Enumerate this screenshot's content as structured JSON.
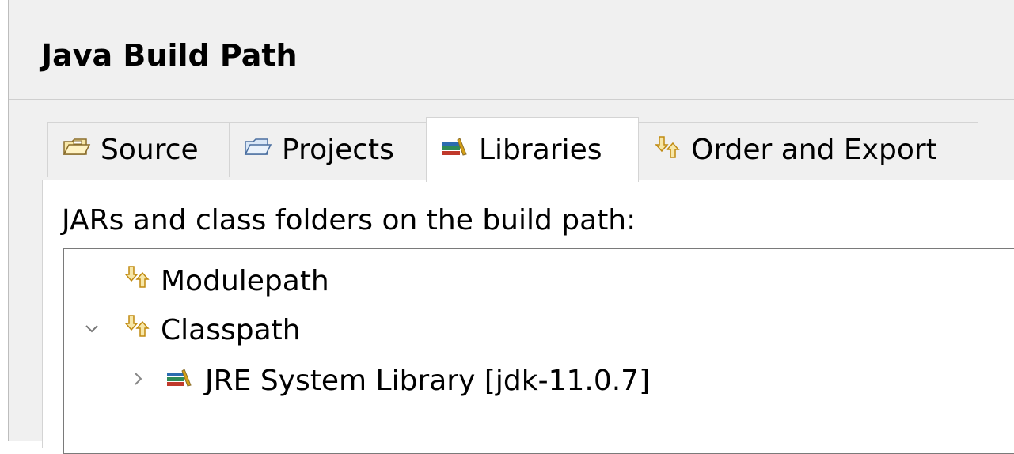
{
  "page": {
    "title": "Java Build Path"
  },
  "tabs": [
    {
      "label": "Source",
      "icon": "source-folder-icon",
      "active": false
    },
    {
      "label": "Projects",
      "icon": "projects-folder-icon",
      "active": false
    },
    {
      "label": "Libraries",
      "icon": "library-icon",
      "active": true
    },
    {
      "label": "Order and Export",
      "icon": "order-export-icon",
      "active": false
    }
  ],
  "libraries_panel": {
    "description": "JARs and class folders on the build path:",
    "tree": [
      {
        "label": "Modulepath",
        "icon": "path-arrows-icon",
        "expanded": null
      },
      {
        "label": "Classpath",
        "icon": "path-arrows-icon",
        "expanded": true
      },
      {
        "label": "JRE System Library [jdk-11.0.7]",
        "icon": "library-icon",
        "expanded": false
      }
    ]
  },
  "colors": {
    "background": "#f0f0f0",
    "panel": "#ffffff",
    "border": "#d4d4d4",
    "tree_border": "#7a7a7a",
    "library_red": "#c0392b",
    "library_green": "#2e8b57",
    "library_blue": "#2b6cb0",
    "arrow_orange": "#e0a020"
  }
}
